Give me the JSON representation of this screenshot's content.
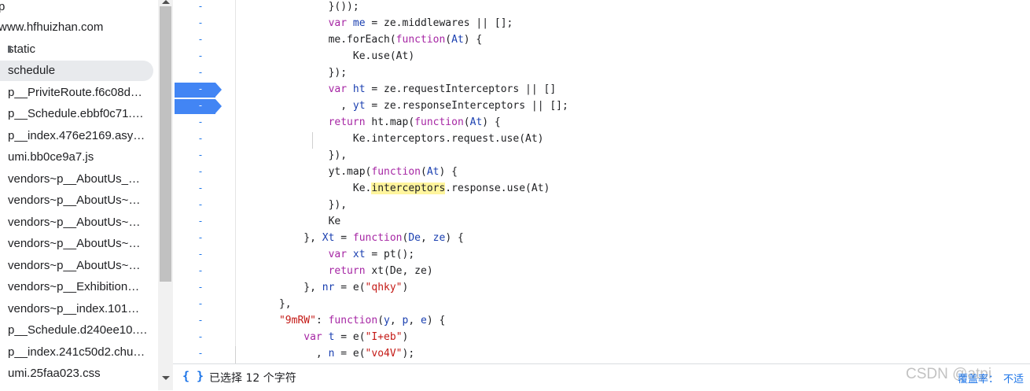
{
  "sidebar": {
    "items": [
      {
        "label": "p",
        "kind": "header"
      },
      {
        "label": "www.hfhuizhan.com",
        "kind": "domain"
      },
      {
        "label": "static",
        "kind": "folder"
      },
      {
        "label": "schedule",
        "kind": "selected"
      },
      {
        "label": "p__PriviteRoute.f6c08d…",
        "kind": "file"
      },
      {
        "label": "p__Schedule.ebbf0c71.…",
        "kind": "file"
      },
      {
        "label": "p__index.476e2169.asy…",
        "kind": "file"
      },
      {
        "label": "umi.bb0ce9a7.js",
        "kind": "file"
      },
      {
        "label": "vendors~p__AboutUs_…",
        "kind": "file"
      },
      {
        "label": "vendors~p__AboutUs~…",
        "kind": "file"
      },
      {
        "label": "vendors~p__AboutUs~…",
        "kind": "file"
      },
      {
        "label": "vendors~p__AboutUs~…",
        "kind": "file"
      },
      {
        "label": "vendors~p__AboutUs~…",
        "kind": "file"
      },
      {
        "label": "vendors~p__Exhibition…",
        "kind": "file"
      },
      {
        "label": "vendors~p__index.101…",
        "kind": "file"
      },
      {
        "label": "p__Schedule.d240ee10.…",
        "kind": "file"
      },
      {
        "label": "p__index.241c50d2.chu…",
        "kind": "file"
      },
      {
        "label": "umi.25faa023.css",
        "kind": "file"
      }
    ]
  },
  "editor": {
    "gutter_marks": [
      "-",
      "-",
      "-",
      "-",
      "-",
      "-",
      "-",
      "-",
      "-",
      "-",
      "-",
      "-",
      "-",
      "-",
      "-",
      "-",
      "-",
      "-",
      "-",
      "-",
      "-",
      "-"
    ],
    "breakpoint_rows": [
      5,
      6
    ]
  },
  "status": {
    "braces": "{ }",
    "selection": "已选择 12 个字符",
    "coverage": "覆盖率：",
    "not_applicable": "不适",
    "watermark": "CSDN @atpi"
  },
  "colors": {
    "accent": "#1a73e8",
    "breakpoint": "#4285f4",
    "keyword": "#a626a4",
    "variable": "#1a3fb0",
    "string": "#c41a16",
    "highlight": "#fff59d"
  }
}
